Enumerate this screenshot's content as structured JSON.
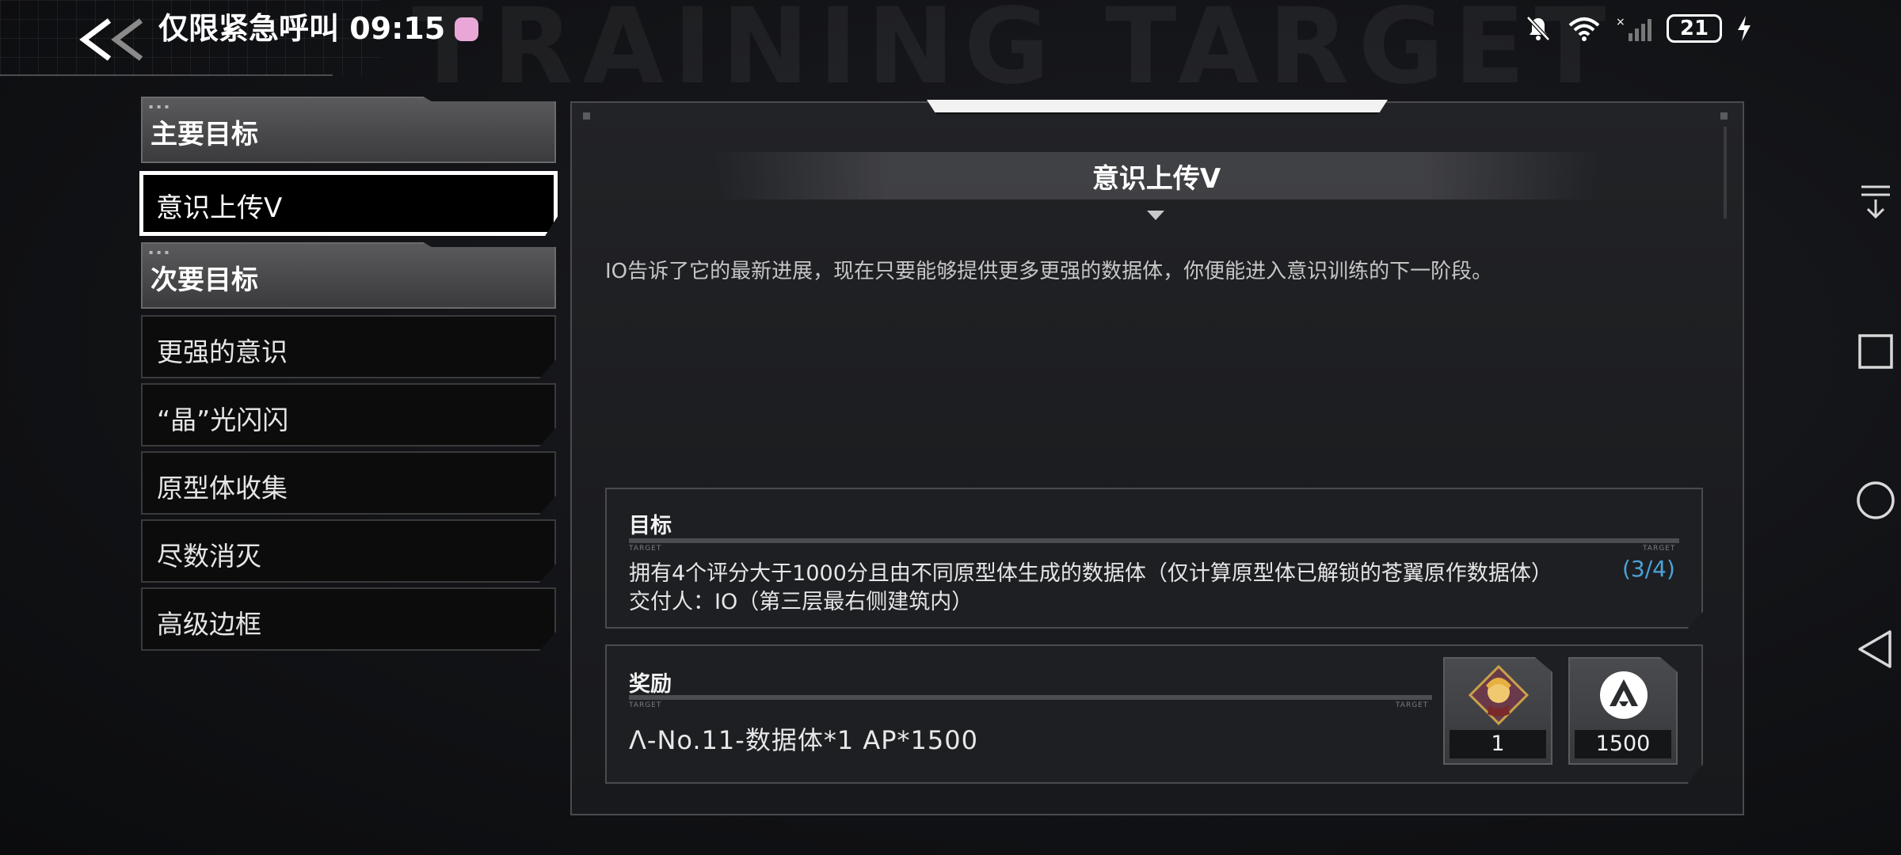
{
  "watermark": "TRAINING TARGET",
  "status_bar": {
    "text": "仅限紧急呼叫 09:15",
    "battery": "21",
    "icons": [
      "mute-bell-icon",
      "wifi-icon",
      "signal-icon",
      "battery-icon",
      "charging-icon"
    ]
  },
  "sidebar": {
    "main_header": "主要目标",
    "main_items": [
      {
        "label": "意识上传V",
        "selected": true
      }
    ],
    "secondary_header": "次要目标",
    "secondary_items": [
      {
        "label": "更强的意识"
      },
      {
        "label": "“晶”光闪闪"
      },
      {
        "label": "原型体收集"
      },
      {
        "label": "尽数消灭"
      },
      {
        "label": "高级边框"
      }
    ]
  },
  "detail": {
    "title": "意识上传V",
    "description": "IO告诉了它的最新进展，现在只要能够提供更多更强的数据体，你便能进入意识训练的下一阶段。",
    "target": {
      "header": "目标",
      "tag": "TARGET",
      "requirement": "拥有4个评分大于1000分且由不同原型体生成的数据体（仅计算原型体已解锁的苍翼原作数据体）",
      "progress": "(3/4)",
      "deliver_to": "交付人：IO（第三层最右侧建筑内）"
    },
    "reward": {
      "header": "奖励",
      "tag": "TARGET",
      "summary": "Λ-No.11-数据体*1  AP*1500",
      "items": [
        {
          "icon": "character-portrait-icon",
          "count": "1"
        },
        {
          "icon": "ap-logo-icon",
          "count": "1500"
        }
      ]
    }
  },
  "colors": {
    "progress": "#4aa3d8",
    "selected_border": "#ffffff",
    "panel_bg": "#1e1f22"
  },
  "nav_bar": [
    "download-icon",
    "recents-square-icon",
    "home-circle-icon",
    "back-triangle-icon"
  ]
}
